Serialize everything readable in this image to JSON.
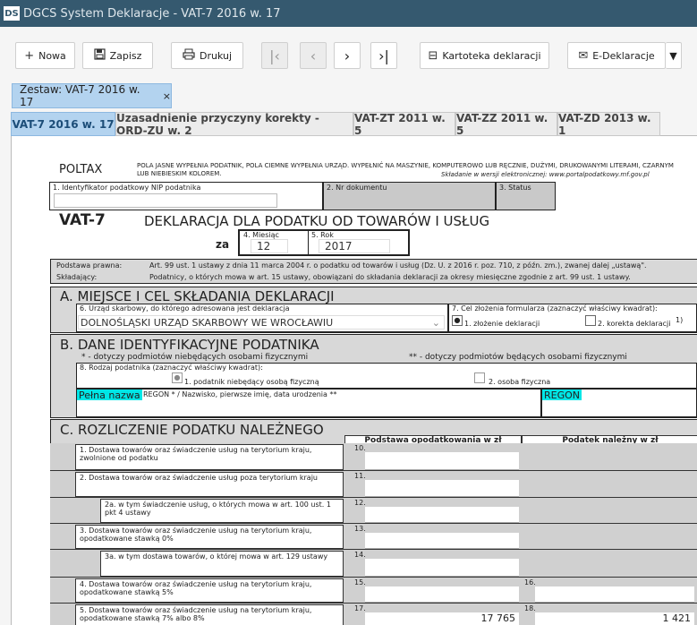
{
  "window": {
    "logo": "DS",
    "title": "DGCS System Deklaracje - VAT-7 2016 w. 17"
  },
  "toolbar": {
    "new_label": "Nowa",
    "save_label": "Zapisz",
    "print_label": "Drukuj",
    "kartoteka_label": "Kartoteka deklaracji",
    "edeklaracje_label": "E-Deklaracje"
  },
  "zestaw": {
    "label": "Zestaw: VAT-7 2016 w. 17",
    "close": "×"
  },
  "tabs": [
    "VAT-7 2016 w. 17",
    "Uzasadnienie przyczyny korekty - ORD-ZU w. 2",
    "VAT-ZT 2011 w. 5",
    "VAT-ZZ 2011 w. 5",
    "VAT-ZD 2013 w. 1"
  ],
  "form": {
    "poltax": "POLTAX",
    "header_note": "POLA JASNE WYPEŁNIA PODATNIK, POLA CIEMNE WYPEŁNIA URZĄD. WYPEŁNIĆ NA MASZYNIE, KOMPUTEROWO LUB RĘCZNIE, DUŻYMI, DRUKOWANYMI LITERAMI, CZARNYM LUB NIEBIESKIM KOLOREM.",
    "header_note2": "Składanie w wersji elektronicznej: www.portalpodatkowy.mf.gov.pl",
    "nip_label": "1. Identyfikator podatkowy NIP podatnika",
    "doc_label": "2. Nr dokumentu",
    "status_label": "3. Status",
    "code": "VAT-7",
    "title": "DEKLARACJA DLA PODATKU OD TOWARÓW I USŁUG",
    "za": "za",
    "month_label": "4. Miesiąc",
    "month_value": "12",
    "year_label": "5. Rok",
    "year_value": "2017",
    "legal_basis_label": "Podstawa prawna:",
    "legal_basis_text": "Art. 99 ust. 1 ustawy z dnia 11 marca 2004 r. o podatku od towarów i usług (Dz. U. z 2016 r. poz. 710, z późn. zm.), zwanej dalej „ustawą\".",
    "submitter_label": "Składający:",
    "submitter_text": "Podatnicy, o których mowa w art. 15 ustawy, obowiązani do składania deklaracji za okresy miesięczne zgodnie z art. 99 ust. 1 ustawy.",
    "sectionA": "A. MIEJSCE I CEL SKŁADANIA DEKLARACJI",
    "office_label": "6. Urząd skarbowy, do którego adresowana jest deklaracja",
    "office_value": "DOLNOŚLĄSKI URZĄD SKARBOWY WE WROCŁAWIU",
    "purpose_label": "7. Cel złożenia formularza (zaznaczyć właściwy kwadrat):",
    "purpose_opt1": "1. złożenie deklaracji",
    "purpose_opt2": "2. korekta deklaracji",
    "purpose_footnote": "1)",
    "sectionB": "B. DANE IDENTYFIKACYJNE PODATNIKA",
    "note_star": "* - dotyczy podmiotów niebędących osobami fizycznymi",
    "note_dstar": "** - dotyczy podmiotów będących osobami fizycznymi",
    "kind_label": "8. Rodzaj podatnika (zaznaczyć właściwy kwadrat):",
    "kind_opt1": "1. podatnik niebędący osobą fizyczną",
    "kind_opt2": "2. osoba fizyczna",
    "fullname_tag": "Pełna nazwa",
    "fullname_label": "REGON * / Nazwisko, pierwsze imię, data urodzenia **",
    "regon_tag": "REGON",
    "sectionC": "C. ROZLICZENIE PODATKU NALEŻNEGO",
    "col1": "Podstawa opodatkowania w zł",
    "col2": "Podatek należny w zł",
    "rows": [
      {
        "label": "1. Dostawa towarów oraz świadczenie usług na terytorium kraju, zwolnione od podatku",
        "n1": "10.",
        "v1": "",
        "n2": "",
        "v2": ""
      },
      {
        "label": "2. Dostawa towarów oraz świadczenie usług poza terytorium kraju",
        "n1": "11.",
        "v1": "",
        "n2": "",
        "v2": ""
      },
      {
        "label": "2a. w tym świadczenie usług, o których mowa w art. 100 ust. 1 pkt 4 ustawy",
        "n1": "12.",
        "v1": "",
        "n2": "",
        "v2": ""
      },
      {
        "label": "3. Dostawa towarów oraz świadczenie usług na terytorium kraju, opodatkowane stawką 0%",
        "n1": "13.",
        "v1": "",
        "n2": "",
        "v2": ""
      },
      {
        "label": "3a. w tym dostawa towarów, o której mowa w art. 129 ustawy",
        "n1": "14.",
        "v1": "",
        "n2": "",
        "v2": ""
      },
      {
        "label": "4. Dostawa towarów oraz świadczenie usług na terytorium kraju, opodatkowane stawką 5%",
        "n1": "15.",
        "v1": "",
        "n2": "16.",
        "v2": ""
      },
      {
        "label": "5. Dostawa towarów oraz świadczenie usług na terytorium kraju, opodatkowane stawką 7% albo 8%",
        "n1": "17.",
        "v1": "17 765",
        "n2": "18.",
        "v2": "1 421"
      }
    ]
  }
}
